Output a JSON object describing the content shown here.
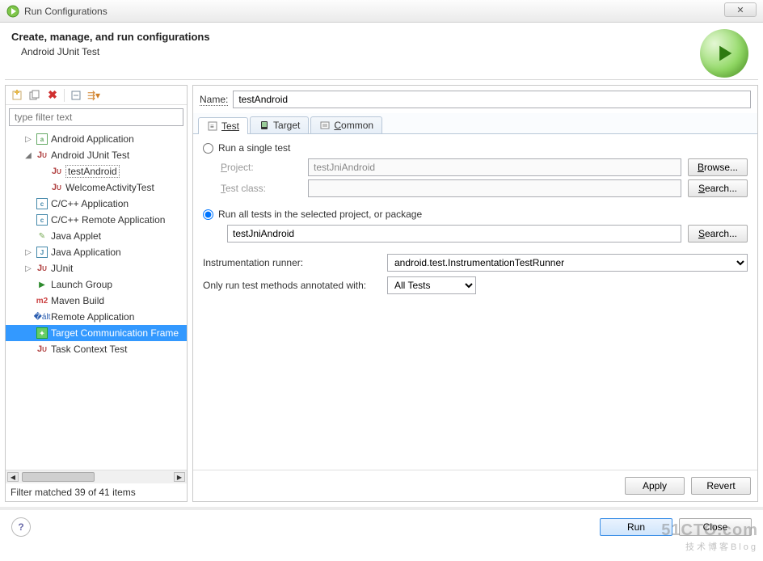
{
  "window": {
    "title": "Run Configurations",
    "close": "✕"
  },
  "header": {
    "title": "Create, manage, and run configurations",
    "subtitle": "Android JUnit Test"
  },
  "left": {
    "filter_placeholder": "type filter text",
    "items": [
      {
        "label": "Android Application",
        "kind": "android",
        "depth": 1,
        "expand": "▷"
      },
      {
        "label": "Android JUnit Test",
        "kind": "ju",
        "depth": 1,
        "expand": "◢"
      },
      {
        "label": "testAndroid",
        "kind": "ju",
        "depth": 2,
        "hl": true
      },
      {
        "label": "WelcomeActivityTest",
        "kind": "ju",
        "depth": 2
      },
      {
        "label": "C/C++ Application",
        "kind": "c",
        "depth": 1
      },
      {
        "label": "C/C++ Remote Application",
        "kind": "c",
        "depth": 1
      },
      {
        "label": "Java Applet",
        "kind": "applet",
        "depth": 1
      },
      {
        "label": "Java Application",
        "kind": "java",
        "depth": 1,
        "expand": "▷"
      },
      {
        "label": "JUnit",
        "kind": "ju",
        "depth": 1,
        "expand": "▷"
      },
      {
        "label": "Launch Group",
        "kind": "launch",
        "depth": 1
      },
      {
        "label": "Maven Build",
        "kind": "maven",
        "depth": 1
      },
      {
        "label": "Remote Application",
        "kind": "remote",
        "depth": 1
      },
      {
        "label": "Target Communication Frame",
        "kind": "tcf",
        "depth": 1,
        "selected": true
      },
      {
        "label": "Task Context Test",
        "kind": "ju",
        "depth": 1
      }
    ],
    "status": "Filter matched 39 of 41 items"
  },
  "right": {
    "name_label": "Name:",
    "name_value": "testAndroid",
    "tabs": {
      "test": "Test",
      "target": "Target",
      "common": "Common"
    },
    "single_label": "Run a single test",
    "project_label": "Project:",
    "project_value": "testJniAndroid",
    "testclass_label": "Test class:",
    "testclass_value": "",
    "browse": "Browse...",
    "search": "Search...",
    "all_label": "Run all tests in the selected project, or package",
    "all_value": "testJniAndroid",
    "instr_label": "Instrumentation runner:",
    "instr_value": "android.test.InstrumentationTestRunner",
    "annot_label": "Only run test methods annotated with:",
    "annot_value": "All Tests",
    "apply": "Apply",
    "revert": "Revert"
  },
  "footer": {
    "help": "?",
    "run": "Run",
    "close": "Close"
  },
  "watermark": {
    "main": "51CTO.com",
    "sub": "技术博客Blog"
  }
}
